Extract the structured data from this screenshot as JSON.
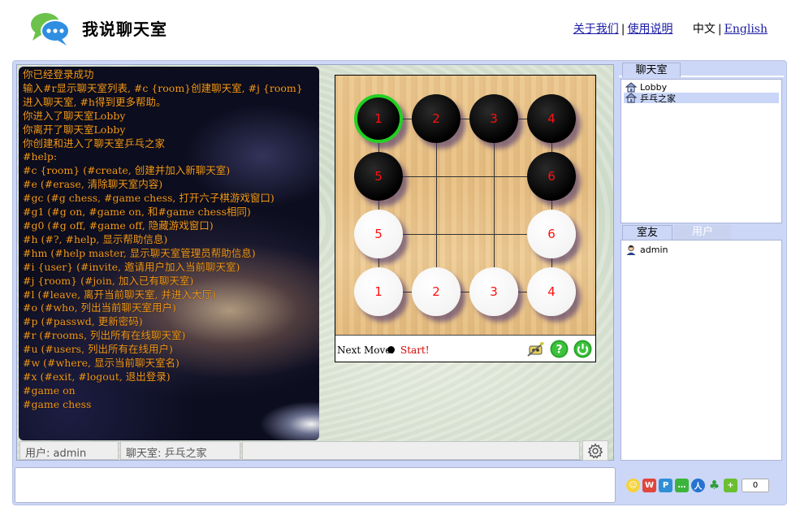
{
  "header": {
    "app_title": "我说聊天室",
    "links": {
      "about": "关于我们",
      "help": "使用说明",
      "current_lang": "中文",
      "english": "English"
    },
    "separator": "|"
  },
  "chat_log": [
    "你已经登录成功",
    "输入#r显示聊天室列表, #c {room}创建聊天室, #j {room}",
    "进入聊天室, #h得到更多帮助。",
    "你进入了聊天室Lobby",
    "你离开了聊天室Lobby",
    "你创建和进入了聊天室乒乓之家",
    "#help:",
    "#c {room} (#create, 创建并加入新聊天室)",
    "#e (#erase, 清除聊天室内容)",
    "#gc (#g chess, #game chess, 打开六子棋游戏窗口)",
    "#g1 (#g on, #game on, 和#game chess相同)",
    "#g0 (#g off, #game off, 隐藏游戏窗口)",
    "#h (#?, #help, 显示帮助信息)",
    "#hm (#help master, 显示聊天室管理员帮助信息)",
    "#i {user} (#invite, 邀请用户加入当前聊天室)",
    "#j {room} (#join, 加入已有聊天室)",
    "#l (#leave, 离开当前聊天室, 并进入大厅)",
    "#o (#who, 列出当前聊天室用户)",
    "#p (#passwd, 更新密码)",
    "#r (#rooms, 列出所有在线聊天室)",
    "#u (#users, 列出所有在线用户)",
    "#w (#where, 显示当前聊天室名)",
    "#x (#exit, #logout, 退出登录)",
    "#game on",
    "#game chess"
  ],
  "game": {
    "stones": [
      {
        "color": "black",
        "label": "1",
        "col": 0,
        "row": 0,
        "selected": true
      },
      {
        "color": "black",
        "label": "2",
        "col": 1,
        "row": 0,
        "selected": false
      },
      {
        "color": "black",
        "label": "3",
        "col": 2,
        "row": 0,
        "selected": false
      },
      {
        "color": "black",
        "label": "4",
        "col": 3,
        "row": 0,
        "selected": false
      },
      {
        "color": "black",
        "label": "5",
        "col": 0,
        "row": 1,
        "selected": false
      },
      {
        "color": "black",
        "label": "6",
        "col": 3,
        "row": 1,
        "selected": false
      },
      {
        "color": "white",
        "label": "5",
        "col": 0,
        "row": 2,
        "selected": false
      },
      {
        "color": "white",
        "label": "6",
        "col": 3,
        "row": 2,
        "selected": false
      },
      {
        "color": "white",
        "label": "1",
        "col": 0,
        "row": 3,
        "selected": false
      },
      {
        "color": "white",
        "label": "2",
        "col": 1,
        "row": 3,
        "selected": false
      },
      {
        "color": "white",
        "label": "3",
        "col": 2,
        "row": 3,
        "selected": false
      },
      {
        "color": "white",
        "label": "4",
        "col": 3,
        "row": 3,
        "selected": false
      }
    ],
    "next_move_label": "Next Move:",
    "next_move_color": "black",
    "start_text": "Start!",
    "icons": [
      "robot-icon",
      "help-icon",
      "power-icon"
    ]
  },
  "status": {
    "user": "用户: admin",
    "room": "聊天室: 乒乓之家"
  },
  "rooms_panel": {
    "tab_label": "聊天室",
    "rooms": [
      {
        "name": "Lobby",
        "selected": false
      },
      {
        "name": "乒乓之家",
        "selected": true
      }
    ]
  },
  "users_panel": {
    "tab_friends": "室友",
    "tab_users": "用户",
    "users": [
      {
        "name": "admin"
      }
    ]
  },
  "share": {
    "count": "0"
  },
  "colors": {
    "chat_text": "#f59a1b",
    "frame_bg": "#ccd7f7",
    "stone_number": "#ff1111",
    "selected_ring": "#22d022",
    "start_text": "#d40000"
  }
}
